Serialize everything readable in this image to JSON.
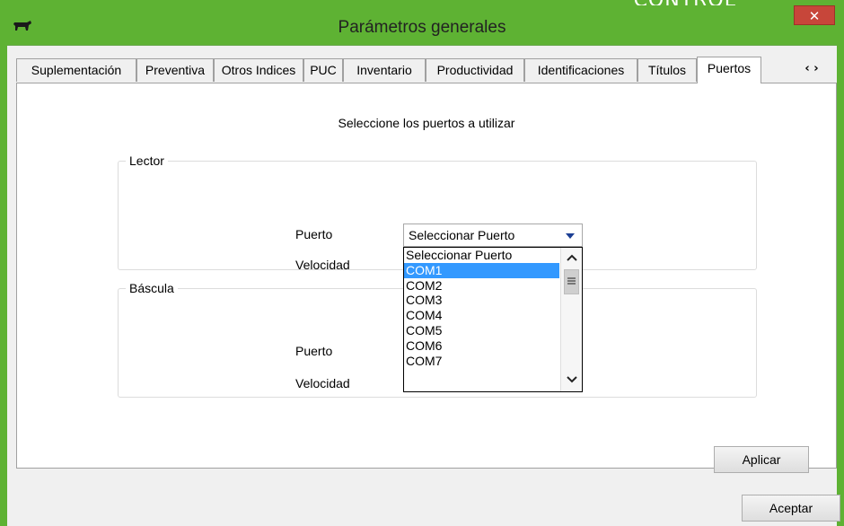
{
  "window": {
    "title": "Parámetros generales",
    "close_glyph": "✕",
    "icon": "cow-icon",
    "accent_color": "#5eb233",
    "behind_text": "CONTROL"
  },
  "tabs": [
    {
      "label": "Suplementación",
      "active": false
    },
    {
      "label": "Preventiva",
      "active": false
    },
    {
      "label": "Otros Indices",
      "active": false
    },
    {
      "label": "PUC",
      "active": false
    },
    {
      "label": "Inventario",
      "active": false
    },
    {
      "label": "Productividad",
      "active": false
    },
    {
      "label": "Identificaciones",
      "active": false
    },
    {
      "label": "Títulos",
      "active": false
    },
    {
      "label": "Puertos",
      "active": true
    }
  ],
  "tab_scroll": {
    "prev": "‹",
    "next": "›"
  },
  "page": {
    "instruction": "Seleccione los puertos a utilizar"
  },
  "lector": {
    "legend": "Lector",
    "port_label": "Puerto",
    "speed_label": "Velocidad",
    "port_value": "Seleccionar Puerto"
  },
  "bascula": {
    "legend": "Báscula",
    "port_label": "Puerto",
    "speed_label": "Velocidad"
  },
  "dropdown": {
    "options": [
      "Seleccionar Puerto",
      "COM1",
      "COM2",
      "COM3",
      "COM4",
      "COM5",
      "COM6",
      "COM7"
    ],
    "highlighted": "COM1",
    "highlight_color": "#3399ff"
  },
  "buttons": {
    "apply": "Aplicar",
    "accept": "Aceptar"
  }
}
